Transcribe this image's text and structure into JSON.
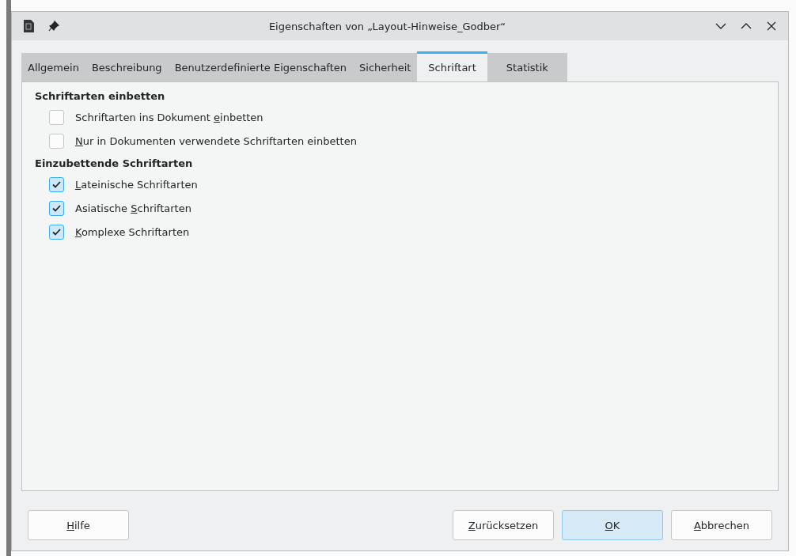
{
  "window": {
    "title": "Eigenschaften von „Layout-Hinweise_Godber“"
  },
  "tabs": [
    {
      "label": "Allgemein",
      "selected": false
    },
    {
      "label": "Beschreibung",
      "selected": false
    },
    {
      "label": "Benutzerdefinierte Eigenschaften",
      "selected": false
    },
    {
      "label": "Sicherheit",
      "selected": false
    },
    {
      "label": "Schriftart",
      "selected": true
    },
    {
      "label": "Statistik",
      "selected": false
    }
  ],
  "sections": [
    {
      "heading": "Schriftarten einbetten",
      "options": [
        {
          "before": "Schriftarten ins Dokument ",
          "mnemonic": "e",
          "after": "inbetten",
          "checked": false
        },
        {
          "mnemonic": "N",
          "after": "ur in Dokumenten verwendete Schriftarten einbetten",
          "checked": false
        }
      ]
    },
    {
      "heading": "Einzubettende Schriftarten",
      "options": [
        {
          "mnemonic": "L",
          "after": "ateinische Schriftarten",
          "checked": true
        },
        {
          "before": "Asiatische ",
          "mnemonic": "S",
          "after": "chriftarten",
          "checked": true
        },
        {
          "mnemonic": "K",
          "after": "omplexe Schriftarten",
          "checked": true
        }
      ]
    }
  ],
  "buttons": [
    {
      "kind": "help",
      "mnemonic": "H",
      "after": "ilfe",
      "default": false
    },
    {
      "kind": "action",
      "mnemonic": "Z",
      "after": "urücksetzen",
      "default": false
    },
    {
      "kind": "action",
      "mnemonic": "O",
      "after": "K",
      "default": true
    },
    {
      "kind": "action",
      "mnemonic": "A",
      "after": "bbrechen",
      "default": false
    }
  ]
}
